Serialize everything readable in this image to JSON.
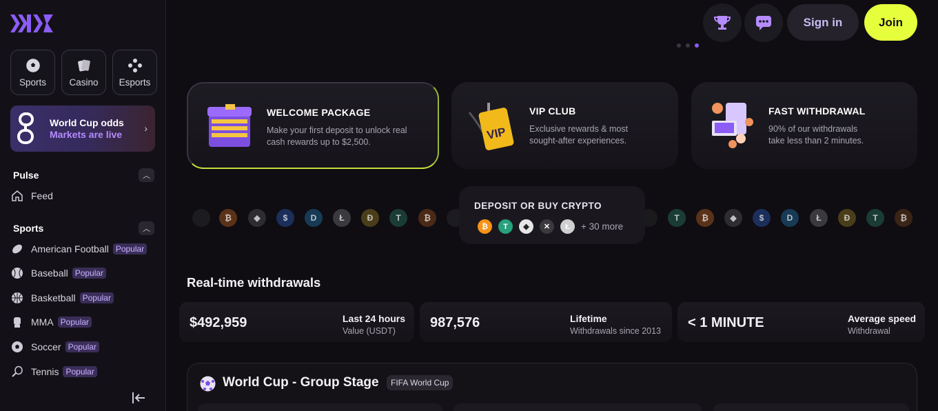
{
  "header": {
    "signin_label": "Sign in",
    "join_label": "Join"
  },
  "sidebar": {
    "tiles": [
      {
        "label": "Sports",
        "icon": "soccer-ball-icon"
      },
      {
        "label": "Casino",
        "icon": "cards-icon"
      },
      {
        "label": "Esports",
        "icon": "gamepad-icon"
      }
    ],
    "promo": {
      "title": "World Cup odds",
      "subtitle": "Markets are live"
    },
    "pulse": {
      "title": "Pulse",
      "items": [
        {
          "label": "Feed",
          "icon": "home-icon"
        }
      ]
    },
    "sports": {
      "title": "Sports",
      "items": [
        {
          "label": "American Football",
          "badge": "Popular",
          "icon": "american-football-icon"
        },
        {
          "label": "Baseball",
          "badge": "Popular",
          "icon": "baseball-icon"
        },
        {
          "label": "Basketball",
          "badge": "Popular",
          "icon": "basketball-icon"
        },
        {
          "label": "MMA",
          "badge": "Popular",
          "icon": "mma-glove-icon"
        },
        {
          "label": "Soccer",
          "badge": "Popular",
          "icon": "soccer-ball-icon"
        },
        {
          "label": "Tennis",
          "badge": "Popular",
          "icon": "tennis-racket-icon"
        }
      ]
    }
  },
  "features": [
    {
      "title": "WELCOME PACKAGE",
      "line1": "Make your first deposit to unlock real",
      "line2": "cash rewards up to $2,500."
    },
    {
      "title": "VIP CLUB",
      "line1": "Exclusive rewards & most",
      "line2": "sought-after experiences."
    },
    {
      "title": "FAST WITHDRAWAL",
      "line1": "90% of our withdrawals",
      "line2": "take less than 2 minutes."
    }
  ],
  "crypto": {
    "title": "DEPOSIT OR BUY CRYPTO",
    "more": "+ 30 more"
  },
  "withdrawals": {
    "title": "Real-time withdrawals",
    "stats": [
      {
        "value": "$492,959",
        "label": "Last 24 hours",
        "sub": "Value (USDT)"
      },
      {
        "value": "987,576",
        "label": "Lifetime",
        "sub": "Withdrawals since 2013"
      },
      {
        "value": "< 1 MINUTE",
        "label": "Average speed",
        "sub": "Withdrawal"
      }
    ]
  },
  "worldcup": {
    "title": "World Cup - Group Stage",
    "tag": "FIFA World Cup"
  },
  "colors": {
    "accent": "#8b5cf6",
    "join": "#e6ff3c",
    "badge_text": "#c9b3ff"
  }
}
